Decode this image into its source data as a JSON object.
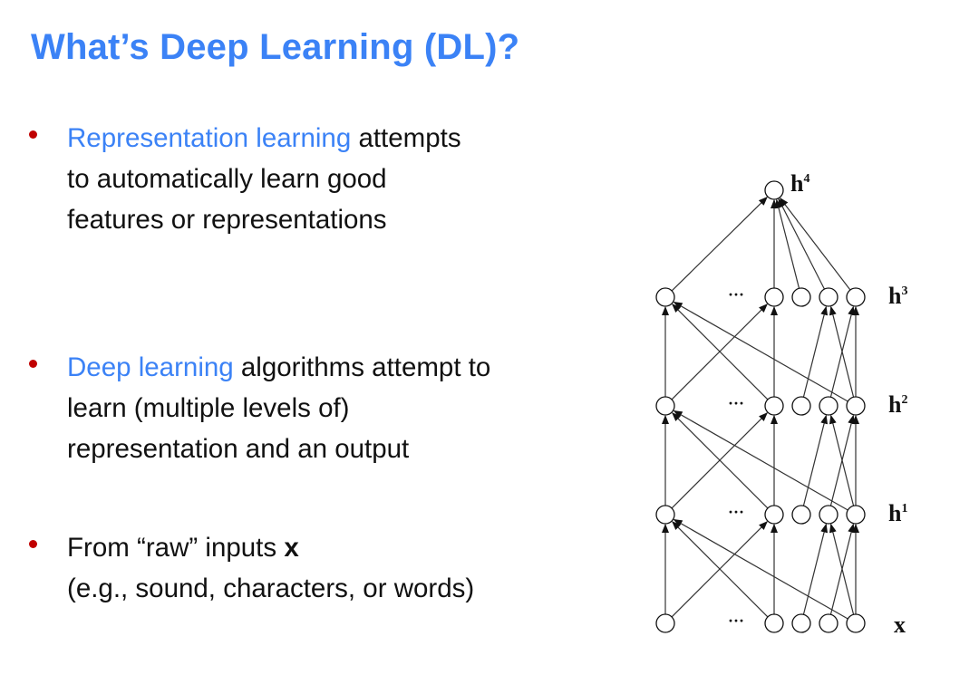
{
  "slide": {
    "title": "What’s Deep Learning (DL)?",
    "bullets": [
      {
        "highlight": "Representation learning",
        "rest": " attempts",
        "line2": "to automatically learn good",
        "line3": "features or representations"
      },
      {
        "highlight": "Deep learning",
        "rest": " algorithms attempt to",
        "line2": "learn (multiple levels of)",
        "line3": "representation and an output"
      },
      {
        "pre": "From “raw” inputs ",
        "bold": "x",
        "line2": "(e.g., sound, characters, or words)"
      }
    ]
  },
  "diagram": {
    "layer_labels": {
      "h4": {
        "base": "h",
        "sup": "4"
      },
      "h3": {
        "base": "h",
        "sup": "3"
      },
      "h2": {
        "base": "h",
        "sup": "2"
      },
      "h1": {
        "base": "h",
        "sup": "1"
      },
      "x": {
        "base": "x"
      }
    },
    "ellipsis": "···",
    "colors": {
      "accent": "#3b82f6",
      "bullet": "#c00000",
      "ink": "#111111",
      "edge": "#333333"
    }
  }
}
